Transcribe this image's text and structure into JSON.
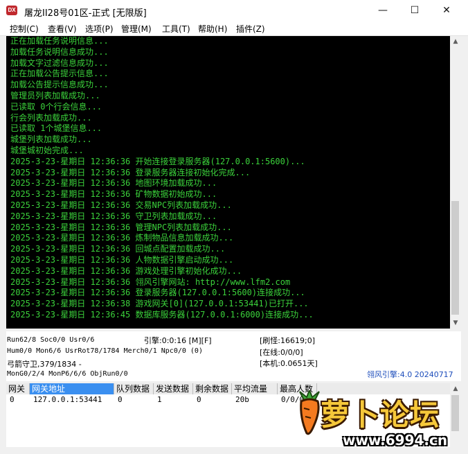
{
  "window": {
    "icon_text": "DX",
    "title": "屠龙II28号01区-正式 [无限版]",
    "minimize": "—",
    "maximize": "☐",
    "close": "✕"
  },
  "menu": [
    {
      "label": "控制(C)"
    },
    {
      "label": "查看(V)"
    },
    {
      "label": "选项(P)"
    },
    {
      "label": "管理(M)"
    },
    {
      "label": "工具(T)"
    },
    {
      "label": "帮助(H)"
    },
    {
      "label": "插件(Z)"
    }
  ],
  "log": {
    "text_color": "#3bd23b",
    "lines": [
      "正在加载任务说明信息...",
      "加载任务说明信息成功...",
      "加载文字过滤信息成功...",
      "正在加载公告提示信息...",
      "加载公告提示信息成功...",
      "管理员列表加载成功...",
      "已读取 0个行会信息...",
      "行会列表加载成功...",
      "已读取 1个城堡信息...",
      "城堡列表加载成功...",
      "城堡城初始完成...",
      "2025-3-23-星期日 12:36:36 开始连接登录服务器(127.0.0.1:5600)...",
      "2025-3-23-星期日 12:36:36 登录服务器连接初始化完成...",
      "2025-3-23-星期日 12:36:36 地图环境加载成功...",
      "2025-3-23-星期日 12:36:36 矿物数据初始成功...",
      "2025-3-23-星期日 12:36:36 交易NPC列表加载成功...",
      "2025-3-23-星期日 12:36:36 守卫列表加载成功...",
      "2025-3-23-星期日 12:36:36 管理NPC列表加载成功...",
      "2025-3-23-星期日 12:36:36 炼制物品信息加载成功...",
      "2025-3-23-星期日 12:36:36 回城点配置加载成功...",
      "2025-3-23-星期日 12:36:36 人物数据引擎启动成功...",
      "2025-3-23-星期日 12:36:36 游戏处理引擎初始化成功...",
      "2025-3-23-星期日 12:36:36 翎风引擎网站: http://www.lfm2.com",
      "2025-3-23-星期日 12:36:36 登录服务器(127.0.0.1:5600)连接成功...",
      "2025-3-23-星期日 12:36:38 游戏网关[0](127.0.0.1:53441)已打开...",
      "2025-3-23-星期日 12:36:45 数据库服务器(127.0.0.1:6000)连接成功..."
    ]
  },
  "status": {
    "run": "Run62/8 Soc0/0 Usr0/6",
    "engine": "引擎:0:0:16 [M][F]",
    "refresh": "[刷怪:16619;0]",
    "hum": "Hum0/0 Mon6/6 UsrRot78/1784 Merch0/1 Npc0/0 (0)",
    "online": "[在线:0/0/0]",
    "archer": "弓箭守卫,379/1834 -",
    "local": "[本机:0.0651天]",
    "mon": "MonG0/2/4 MonP6/6/6 ObjRun0/0",
    "version": "翎风引擎:4.0 20240717"
  },
  "grid": {
    "columns": [
      "网关",
      "网关地址",
      "队列数据",
      "发送数据",
      "剩余数据",
      "平均流量",
      "最高人数"
    ],
    "rows": [
      [
        "0",
        "127.0.0.1:53441",
        "0",
        "1",
        "0",
        "20b",
        "0/0/0"
      ]
    ]
  },
  "watermark": {
    "title": "萝卜论坛",
    "url": "www.6994.cn"
  }
}
